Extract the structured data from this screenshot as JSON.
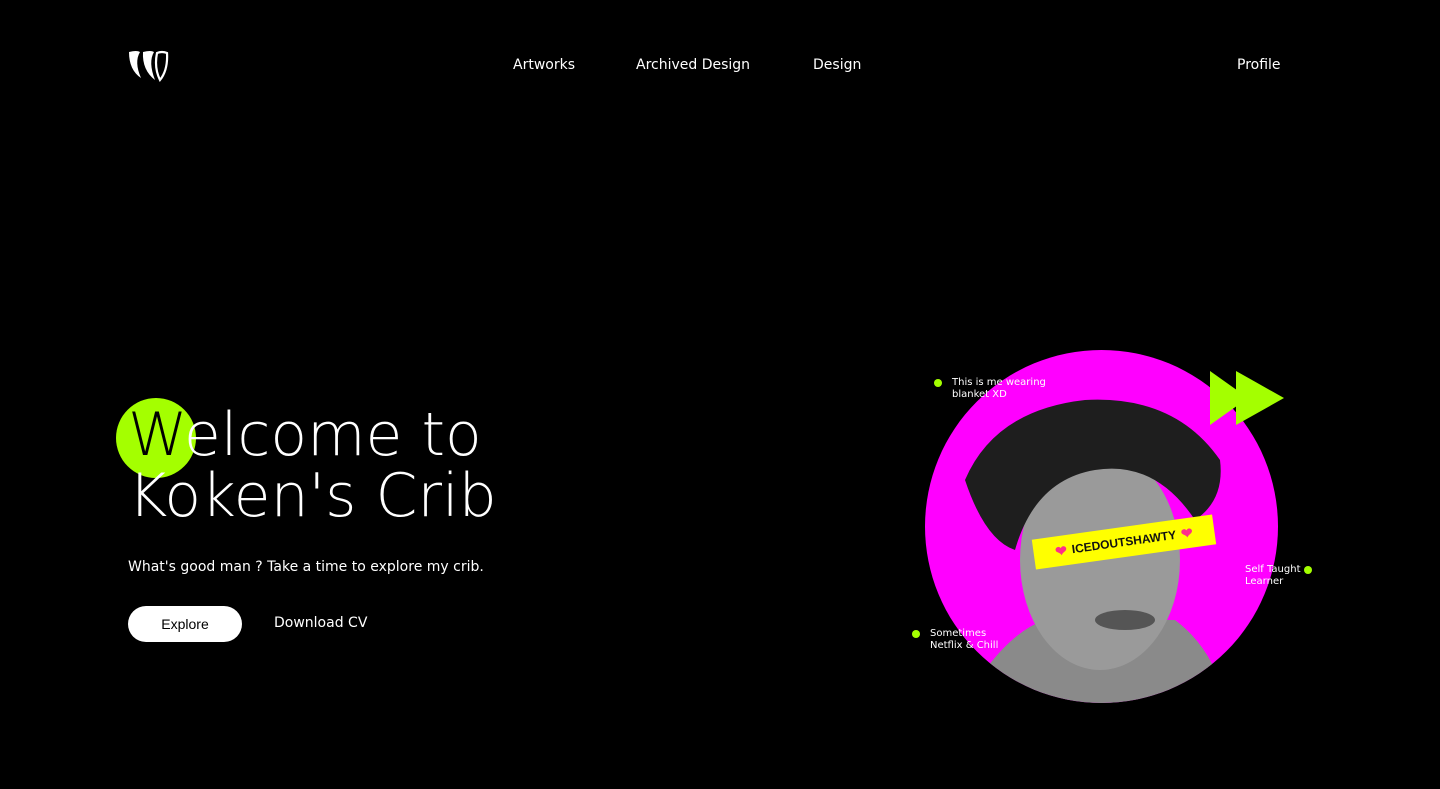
{
  "header": {
    "logo_icon": "triple-claw-logo",
    "nav": [
      "Artworks",
      "Archived Design",
      "Design"
    ],
    "profile": "Profile"
  },
  "hero": {
    "title_first_letter": "W",
    "title_line1_rest": "elcome to",
    "title_line2": "Koken's Crib",
    "subtitle": "What's good man ? Take a time to explore my crib.",
    "explore_label": "Explore",
    "download_label": "Download CV"
  },
  "portrait": {
    "tag_text": "ICEDOUTSHAWTY",
    "captions": {
      "top_left": [
        "This is me wearing",
        "blanket XD"
      ],
      "right": [
        "Self Taught",
        "Learner"
      ],
      "bottom_left": [
        "Sometimes",
        "Netflix & Chill"
      ]
    }
  },
  "colors": {
    "accent": "#a4ff00",
    "magenta": "#ff00ff",
    "tag": "#ffff00",
    "background": "#000000"
  }
}
